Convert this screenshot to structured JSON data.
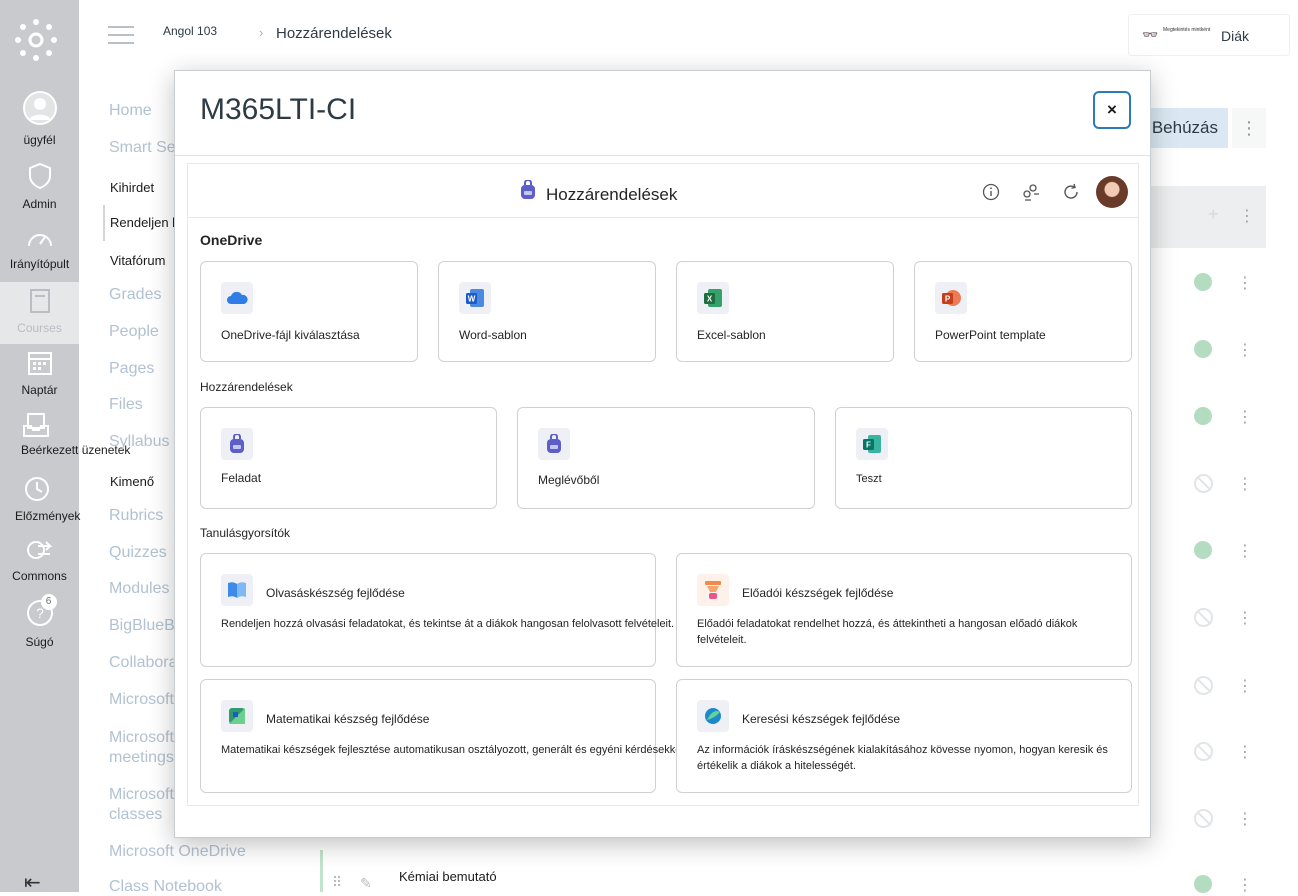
{
  "global_nav": {
    "items": [
      {
        "label": "ügyfél",
        "icon": "avatar-icon"
      },
      {
        "label": "Admin",
        "icon": "shield-icon"
      },
      {
        "label": "Irányítópult",
        "icon": "dashboard-icon"
      },
      {
        "label": "Courses",
        "icon": "book-icon"
      },
      {
        "label": "Naptár",
        "icon": "calendar-icon"
      },
      {
        "label": "Beérkezett üzenetek",
        "icon": "inbox-icon"
      },
      {
        "label": "Előzmények",
        "icon": "clock-icon"
      },
      {
        "label": "Commons",
        "icon": "commons-icon"
      },
      {
        "label": "Súgó",
        "icon": "help-icon",
        "badge": "6"
      }
    ]
  },
  "header": {
    "breadcrumb_course": "Angol 103",
    "breadcrumb_page": "Hozzárendelések",
    "student_view_small": "Megtekintés mintként",
    "student_view_label": "Diák"
  },
  "course_nav": {
    "items": [
      "Home",
      "Smart Search",
      "Kihirdet",
      "Rendeljen hozzá",
      "Vitafórum",
      "Grades",
      "People",
      "Pages",
      "Files",
      "Syllabus",
      "Kimenő",
      "Rubrics",
      "Quizzes",
      "Modules",
      "BigBlueButton",
      "Collaborations",
      "Microsoft",
      "Microsoft meetings",
      "Microsoft classes",
      "Microsoft OneDrive",
      "Class Notebook"
    ]
  },
  "background": {
    "behuzas_button": "Behúzás",
    "kebab": "⋮",
    "bottom_item_title": "Kémiai bemutató"
  },
  "modal": {
    "title": "M365LTI-CI",
    "close": "×",
    "app_header_title": "Hozzárendelések",
    "sections": {
      "onedrive": "OneDrive",
      "assignments": "Hozzárendelések",
      "accelerators": "Tanulásgyorsítók"
    },
    "onedrive_cards": [
      {
        "label": "OneDrive-fájl kiválasztása",
        "icon": "onedrive-icon"
      },
      {
        "label": "Word-sablon",
        "icon": "word-icon"
      },
      {
        "label": "Excel-sablon",
        "icon": "excel-icon"
      },
      {
        "label": "PowerPoint template",
        "icon": "powerpoint-icon"
      }
    ],
    "assignment_cards": [
      {
        "label": "Feladat",
        "icon": "backpack-icon"
      },
      {
        "label": "Meglévőből",
        "icon": "backpack-icon"
      },
      {
        "label": "Teszt",
        "icon": "forms-icon"
      }
    ],
    "accelerator_cards": [
      {
        "label": "Olvasáskészség fejlődése",
        "desc": "Rendeljen hozzá olvasási feladatokat, és tekintse át a diákok hangosan felolvasott felvételeit.",
        "icon": "reading-icon"
      },
      {
        "label": "Előadói készségek fejlődése",
        "desc": "Előadói feladatokat rendelhet hozzá, és áttekintheti a hangosan előadó diákok felvételeit.",
        "icon": "speaker-icon"
      },
      {
        "label": "Matematikai készség fejlődése",
        "desc": "Matematikai készségek fejlesztése automatikusan osztályozott, generált és egyéni kérdésekkel.",
        "icon": "math-icon"
      },
      {
        "label": "Keresési készségek fejlődése",
        "desc": "Az információk íráskészségének kialakításához kövesse nyomon, hogyan keresik és értékelik a diákok a hitelességét.",
        "icon": "search-progress-icon"
      }
    ]
  },
  "colors": {
    "accent": "#2b7abc",
    "nav_bg": "#c8cacd",
    "ok_status": "#b4dcc1"
  }
}
